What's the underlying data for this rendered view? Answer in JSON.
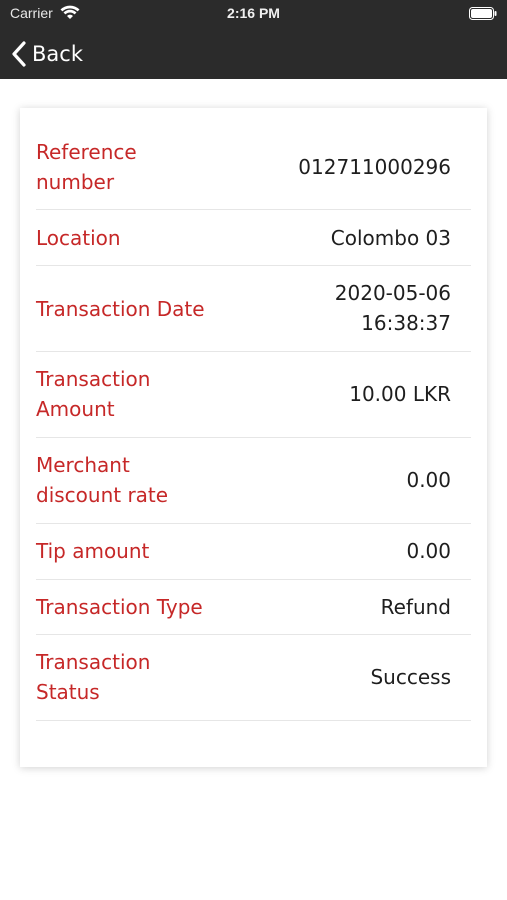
{
  "status_bar": {
    "carrier": "Carrier",
    "time": "2:16 PM"
  },
  "nav": {
    "back_label": "Back"
  },
  "details": {
    "reference_label_1": "Reference",
    "reference_label_2": "number",
    "reference_value": "012711000296",
    "location_label": "Location",
    "location_value": "Colombo 03",
    "date_label": "Transaction Date",
    "date_value_1": "2020-05-06",
    "date_value_2": "16:38:37",
    "amount_label_1": "Transaction",
    "amount_label_2": "Amount",
    "amount_value": "10.00 LKR",
    "mdr_label_1": "Merchant",
    "mdr_label_2": "discount rate",
    "mdr_value": "0.00",
    "tip_label": "Tip amount",
    "tip_value": "0.00",
    "type_label": "Transaction Type",
    "type_value": "Refund",
    "status_label_1": "Transaction",
    "status_label_2": "Status",
    "status_value": "Success"
  },
  "colors": {
    "label": "#c62828",
    "value": "#1e1e1e",
    "bar": "#2b2b2b"
  }
}
